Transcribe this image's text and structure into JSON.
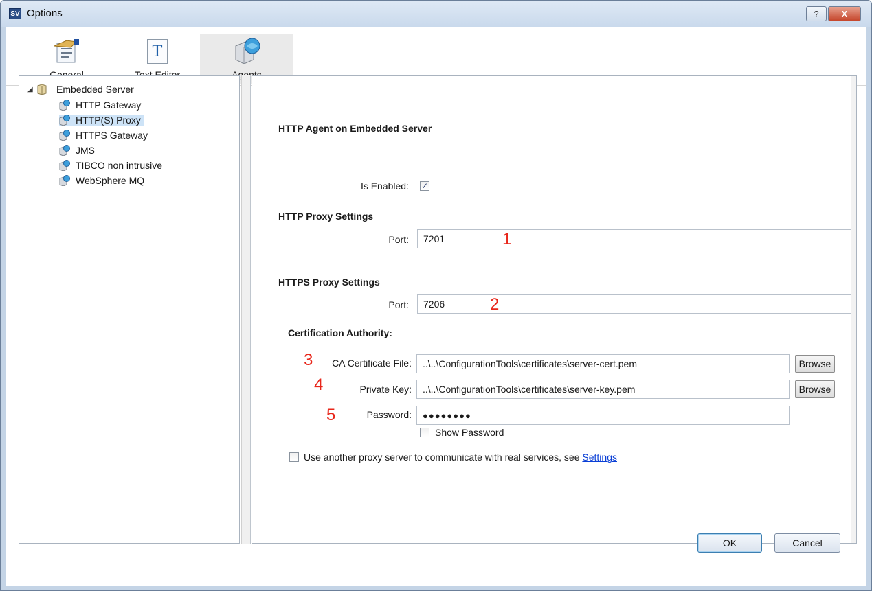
{
  "window": {
    "title": "Options",
    "app_icon_text": "SV",
    "help_glyph": "?",
    "close_glyph": "X"
  },
  "toolbar": {
    "items": [
      {
        "label": "General",
        "icon": "general-settings-icon"
      },
      {
        "label": "Text Editor",
        "icon": "text-editor-icon",
        "glyph": "T"
      },
      {
        "label": "Agents",
        "icon": "agents-icon",
        "selected": true
      }
    ]
  },
  "tree": {
    "root": {
      "label": "Embedded Server",
      "expanded": true,
      "arrow": "◢"
    },
    "children": [
      {
        "label": "HTTP Gateway"
      },
      {
        "label": "HTTP(S) Proxy",
        "selected": true
      },
      {
        "label": "HTTPS Gateway"
      },
      {
        "label": "JMS"
      },
      {
        "label": "TIBCO non intrusive"
      },
      {
        "label": "WebSphere MQ"
      }
    ]
  },
  "panel": {
    "title": "HTTP Agent on Embedded Server",
    "is_enabled_label": "Is Enabled:",
    "is_enabled": true,
    "http_heading": "HTTP Proxy Settings",
    "http_port_label": "Port:",
    "http_port": "7201",
    "https_heading": "HTTPS Proxy Settings",
    "https_port_label": "Port:",
    "https_port": "7206",
    "ca_heading": "Certification Authority:",
    "ca_file_label": "CA Certificate File:",
    "ca_file": "..\\..\\ConfigurationTools\\certificates\\server-cert.pem",
    "private_key_label": "Private Key:",
    "private_key": "..\\..\\ConfigurationTools\\certificates\\server-key.pem",
    "password_label": "Password:",
    "password_mask": "●●●●●●●●",
    "show_password_label": "Show Password",
    "show_password": false,
    "browse_label": "Browse",
    "proxy_text": "Use another proxy server to communicate with real services, see",
    "proxy_link": "Settings",
    "use_proxy": false,
    "checkmark": "✓"
  },
  "annotations": [
    "1",
    "2",
    "3",
    "4",
    "5"
  ],
  "footer": {
    "ok_label": "OK",
    "cancel_label": "Cancel"
  },
  "colors": {
    "annotation": "#e8261a",
    "link": "#0a3fd6",
    "selection": "#cde3f7"
  }
}
